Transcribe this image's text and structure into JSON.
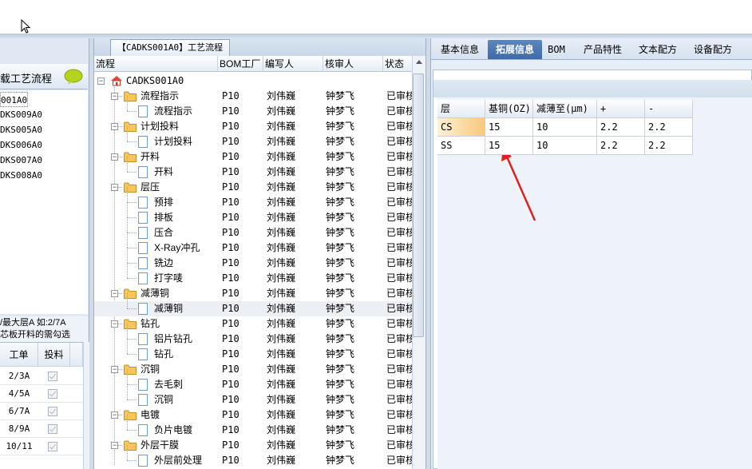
{
  "left": {
    "title": "载工艺流程",
    "list_items": [
      "001A0",
      "DKS009A0",
      "DKS005A0",
      "DKS006A0",
      "DKS007A0",
      "DKS008A0"
    ],
    "note_line1": "/最大层A 如:2/7A",
    "note_line2": "芯板开料的需勾选",
    "grid_headers": [
      "工单",
      "投料"
    ],
    "grid_rows": [
      "2/3A",
      "4/5A",
      "6/7A",
      "8/9A",
      "10/11"
    ]
  },
  "middle": {
    "tab_label": "【CADKS001A0】工艺流程",
    "headers": [
      "流程",
      "BOM工厂",
      "编写人",
      "核审人",
      "状态"
    ],
    "root_label": "CADKS001A0",
    "rows": [
      {
        "name": "流程指示",
        "level": 1,
        "factory": "P10",
        "writer": "刘伟巍",
        "reviewer": "钟梦飞",
        "status": "已审核"
      },
      {
        "name": "流程指示",
        "level": 2,
        "factory": "P10",
        "writer": "刘伟巍",
        "reviewer": "钟梦飞",
        "status": "已审核"
      },
      {
        "name": "计划投料",
        "level": 1,
        "factory": "P10",
        "writer": "刘伟巍",
        "reviewer": "钟梦飞",
        "status": "已审核"
      },
      {
        "name": "计划投料",
        "level": 2,
        "factory": "P10",
        "writer": "刘伟巍",
        "reviewer": "钟梦飞",
        "status": "已审核"
      },
      {
        "name": "开料",
        "level": 1,
        "factory": "P10",
        "writer": "刘伟巍",
        "reviewer": "钟梦飞",
        "status": "已审核"
      },
      {
        "name": "开料",
        "level": 2,
        "factory": "P10",
        "writer": "刘伟巍",
        "reviewer": "钟梦飞",
        "status": "已审核"
      },
      {
        "name": "层压",
        "level": 1,
        "factory": "P10",
        "writer": "刘伟巍",
        "reviewer": "钟梦飞",
        "status": "已审核"
      },
      {
        "name": "预排",
        "level": 2,
        "factory": "P10",
        "writer": "刘伟巍",
        "reviewer": "钟梦飞",
        "status": "已审核"
      },
      {
        "name": "排板",
        "level": 2,
        "factory": "P10",
        "writer": "刘伟巍",
        "reviewer": "钟梦飞",
        "status": "已审核"
      },
      {
        "name": "压合",
        "level": 2,
        "factory": "P10",
        "writer": "刘伟巍",
        "reviewer": "钟梦飞",
        "status": "已审核"
      },
      {
        "name": "X-Ray冲孔",
        "level": 2,
        "factory": "P10",
        "writer": "刘伟巍",
        "reviewer": "钟梦飞",
        "status": "已审核"
      },
      {
        "name": "铣边",
        "level": 2,
        "factory": "P10",
        "writer": "刘伟巍",
        "reviewer": "钟梦飞",
        "status": "已审核"
      },
      {
        "name": "打字唛",
        "level": 2,
        "factory": "P10",
        "writer": "刘伟巍",
        "reviewer": "钟梦飞",
        "status": "已审核"
      },
      {
        "name": "减薄铜",
        "level": 1,
        "factory": "P10",
        "writer": "刘伟巍",
        "reviewer": "钟梦飞",
        "status": "已审核"
      },
      {
        "name": "减薄铜",
        "level": 2,
        "factory": "P10",
        "writer": "刘伟巍",
        "reviewer": "钟梦飞",
        "status": "已审核",
        "selected": true
      },
      {
        "name": "钻孔",
        "level": 1,
        "factory": "P10",
        "writer": "刘伟巍",
        "reviewer": "钟梦飞",
        "status": "已审核"
      },
      {
        "name": "铝片钻孔",
        "level": 2,
        "factory": "P10",
        "writer": "刘伟巍",
        "reviewer": "钟梦飞",
        "status": "已审核"
      },
      {
        "name": "钻孔",
        "level": 2,
        "factory": "P10",
        "writer": "刘伟巍",
        "reviewer": "钟梦飞",
        "status": "已审核"
      },
      {
        "name": "沉铜",
        "level": 1,
        "factory": "P10",
        "writer": "刘伟巍",
        "reviewer": "钟梦飞",
        "status": "已审核"
      },
      {
        "name": "去毛刺",
        "level": 2,
        "factory": "P10",
        "writer": "刘伟巍",
        "reviewer": "钟梦飞",
        "status": "已审核"
      },
      {
        "name": "沉铜",
        "level": 2,
        "factory": "P10",
        "writer": "刘伟巍",
        "reviewer": "钟梦飞",
        "status": "已审核"
      },
      {
        "name": "电镀",
        "level": 1,
        "factory": "P10",
        "writer": "刘伟巍",
        "reviewer": "钟梦飞",
        "status": "已审核"
      },
      {
        "name": "负片电镀",
        "level": 2,
        "factory": "P10",
        "writer": "刘伟巍",
        "reviewer": "钟梦飞",
        "status": "已审核"
      },
      {
        "name": "外层干膜",
        "level": 1,
        "factory": "P10",
        "writer": "刘伟巍",
        "reviewer": "钟梦飞",
        "status": "已审核"
      },
      {
        "name": "外层前处理",
        "level": 2,
        "factory": "P10",
        "writer": "刘伟巍",
        "reviewer": "钟梦飞",
        "status": "已审核"
      }
    ]
  },
  "right": {
    "tabs": [
      "基本信息",
      "拓展信息",
      "BOM",
      "产品特性",
      "文本配方",
      "设备配方"
    ],
    "active_tab": "拓展信息",
    "grid_headers": [
      "层",
      "基铜(OZ)",
      "减薄至(μm)",
      "+",
      "-"
    ],
    "grid_rows": [
      [
        "CS",
        "15",
        "10",
        "2.2",
        "2.2"
      ],
      [
        "SS",
        "15",
        "10",
        "2.2",
        "2.2"
      ]
    ]
  },
  "colors": {
    "accent": "#4a76b2",
    "annotation_arrow": "#e02020"
  }
}
